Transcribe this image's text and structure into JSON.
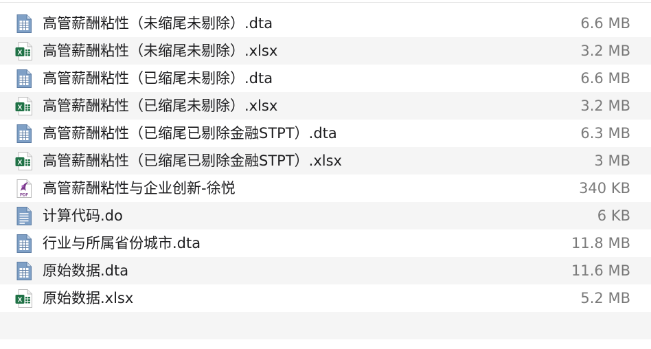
{
  "files": [
    {
      "name": "高管薪酬粘性（未缩尾未剔除）.dta",
      "size": "6.6 MB",
      "icon": "dta-file-icon"
    },
    {
      "name": "高管薪酬粘性（未缩尾未剔除）.xlsx",
      "size": "3.2 MB",
      "icon": "excel-file-icon"
    },
    {
      "name": "高管薪酬粘性（已缩尾未剔除）.dta",
      "size": "6.6 MB",
      "icon": "dta-file-icon"
    },
    {
      "name": "高管薪酬粘性（已缩尾未剔除）.xlsx",
      "size": "3.2 MB",
      "icon": "excel-file-icon"
    },
    {
      "name": "高管薪酬粘性（已缩尾已剔除金融STPT）.dta",
      "size": "6.3 MB",
      "icon": "dta-file-icon"
    },
    {
      "name": "高管薪酬粘性（已缩尾已剔除金融STPT）.xlsx",
      "size": "3 MB",
      "icon": "excel-file-icon"
    },
    {
      "name": "高管薪酬粘性与企业创新-徐悦",
      "size": "340 KB",
      "icon": "pdf-file-icon"
    },
    {
      "name": "计算代码.do",
      "size": "6 KB",
      "icon": "text-file-icon"
    },
    {
      "name": "行业与所属省份城市.dta",
      "size": "11.8 MB",
      "icon": "dta-file-icon"
    },
    {
      "name": "原始数据.dta",
      "size": "11.6 MB",
      "icon": "dta-file-icon"
    },
    {
      "name": "原始数据.xlsx",
      "size": "5.2 MB",
      "icon": "excel-file-icon"
    }
  ],
  "colors": {
    "stripe": "#f5f5f5",
    "name_text": "#1d1d1f",
    "size_text": "#7a7a7a",
    "dta_icon": "#5b7ba3",
    "excel_icon": "#1e7145",
    "pdf_icon": "#7b3b8c"
  }
}
